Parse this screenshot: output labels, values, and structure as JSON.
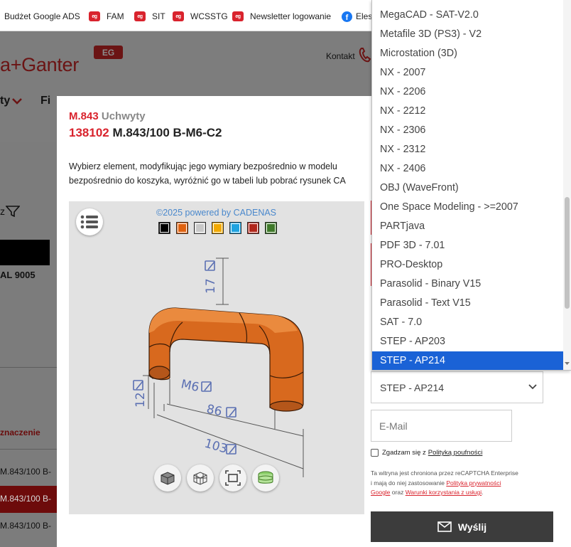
{
  "bookmarks": [
    {
      "label": "Budżet Google ADS",
      "icon": "none"
    },
    {
      "label": "FAM",
      "icon": "eg-icon"
    },
    {
      "label": "SIT",
      "icon": "eg-icon"
    },
    {
      "label": "WCSSTG",
      "icon": "eg-icon"
    },
    {
      "label": "Newsletter logowanie",
      "icon": "eg-icon"
    },
    {
      "label": "Eles",
      "icon": "facebook-icon"
    }
  ],
  "header": {
    "logo_text": "a+Ganter",
    "logo_badge": "EG",
    "contact_label": "Kontakt",
    "nav_item_1": "ty",
    "nav_item_2": "Fi"
  },
  "background": {
    "filter_label": "z",
    "ral_label": "AL 9005",
    "column_header": "znaczenie",
    "rows": [
      "M.843/100 B-",
      "M.843/100 B-",
      "M.843/100 B-"
    ]
  },
  "product": {
    "series_code": "M.843",
    "series_name": "Uchwyty",
    "item_code": "138102",
    "item_name": "M.843/100 B-M6-C2",
    "description_line1": "Wybierz element, modyfikując jego wymiary bezpośrednio w modelu",
    "description_line2": "bezpośrednio do koszyka, wyróżnić go w tabeli lub pobrać rysunek CA"
  },
  "viewer": {
    "powered_by": "©2025 powered by CADENAS",
    "colors": [
      "#000000",
      "#e0620f",
      "#c8c8c8",
      "#f2a900",
      "#1fa3e0",
      "#b1271b",
      "#3f7a2a"
    ],
    "dimensions": {
      "height": "17",
      "thread": "M6",
      "inner": "86",
      "outer": "103",
      "side": "12"
    },
    "model_color": "#d8691e"
  },
  "dropdown": {
    "options": [
      "MegaCAD - SAT-V2.0",
      "Metafile 3D (PS3) - V2",
      "Microstation (3D)",
      "NX - 2007",
      "NX - 2206",
      "NX - 2212",
      "NX - 2306",
      "NX - 2312",
      "NX - 2406",
      "OBJ (WaveFront)",
      "One Space Modeling - >=2007",
      "PARTjava",
      "PDF 3D - 7.01",
      "PRO-Desktop",
      "Parasolid - Binary V15",
      "Parasolid - Text V15",
      "SAT - 7.0",
      "STEP - AP203",
      "STEP - AP214"
    ],
    "selected": "STEP - AP214"
  },
  "form": {
    "format_value": "STEP - AP214",
    "email_placeholder": "E-Mail",
    "consent_text": "Zgadzam się z",
    "consent_link": "Polityką poufności",
    "recaptcha_text_1": "Ta witryna jest chroniona przez reCAPTCHA Enterprise i mają do niej zastosowanie",
    "recaptcha_link_1": "Polityka prywatności Google",
    "recaptcha_text_2": "oraz",
    "recaptcha_link_2": "Warunki korzystania z usługi",
    "recaptcha_end": ".",
    "send_label": "Wyślij"
  }
}
